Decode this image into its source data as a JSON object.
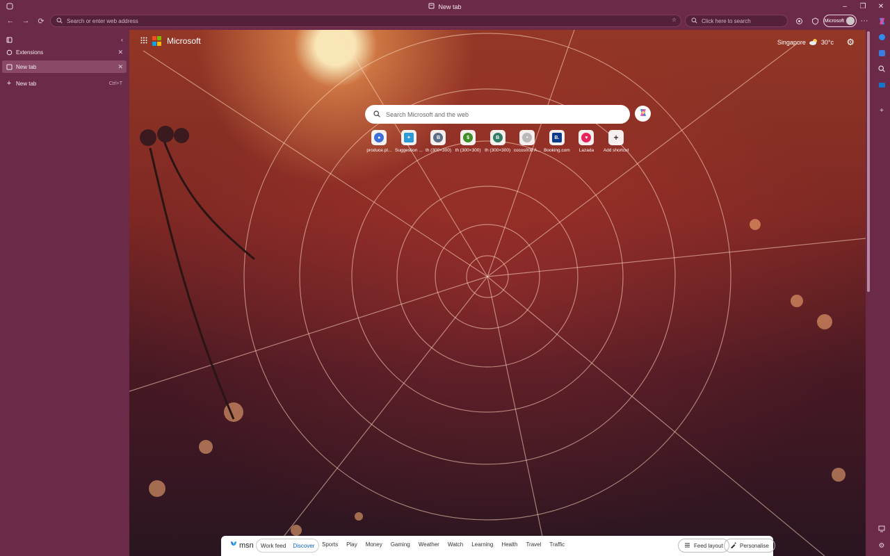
{
  "window": {
    "tab_title": "New tab"
  },
  "toolbar": {
    "address_placeholder": "Search or enter web address",
    "search_placeholder": "Click here to search",
    "profile_label": "Microsoft"
  },
  "sidebar": {
    "items": [
      {
        "label": "Extensions"
      },
      {
        "label": "New tab"
      }
    ],
    "new_tab": {
      "label": "New tab",
      "shortcut": "Ctrl+T"
    }
  },
  "page": {
    "brand": "Microsoft",
    "weather": {
      "location": "Singapore",
      "temp": "30°c"
    },
    "search_placeholder": "Search Microsoft and the web",
    "shortcuts": [
      {
        "label": "produce.pl...",
        "letter": "",
        "color": "#3b6fd9",
        "icon": "globe-icon"
      },
      {
        "label": "Suggestion ...",
        "letter": "",
        "color": "#2a9bd8",
        "icon": "suggestion-icon"
      },
      {
        "label": "th (300×300)",
        "letter": "B",
        "color": "#5a6e86",
        "icon": "letter-b-icon"
      },
      {
        "label": "th (300×300)",
        "letter": "$",
        "color": "#3e8e2a",
        "icon": "dollar-icon"
      },
      {
        "label": "th (300×300)",
        "letter": "B",
        "color": "#2f7d66",
        "icon": "letter-b-icon"
      },
      {
        "label": "cocos008 A...",
        "letter": "",
        "color": "#8a8a8a",
        "icon": "site-icon"
      },
      {
        "label": "Booking.com",
        "letter": "B.",
        "color": "#0c3b8c",
        "icon": "booking-icon"
      },
      {
        "label": "Lazada",
        "letter": "",
        "color": "#e8235b",
        "icon": "lazada-icon"
      },
      {
        "label": "Add shortcut",
        "letter": "+",
        "color": "#ffffff",
        "icon": "plus-icon"
      }
    ]
  },
  "msn": {
    "logo": "msn",
    "modes": [
      "Work feed",
      "Discover"
    ],
    "active_mode": "Discover",
    "categories": [
      "Sports",
      "Play",
      "Money",
      "Gaming",
      "Weather",
      "Watch",
      "Learning",
      "Health",
      "Travel",
      "Traffic"
    ],
    "feed_layout": "Feed layout",
    "personalise": "Personalise"
  }
}
